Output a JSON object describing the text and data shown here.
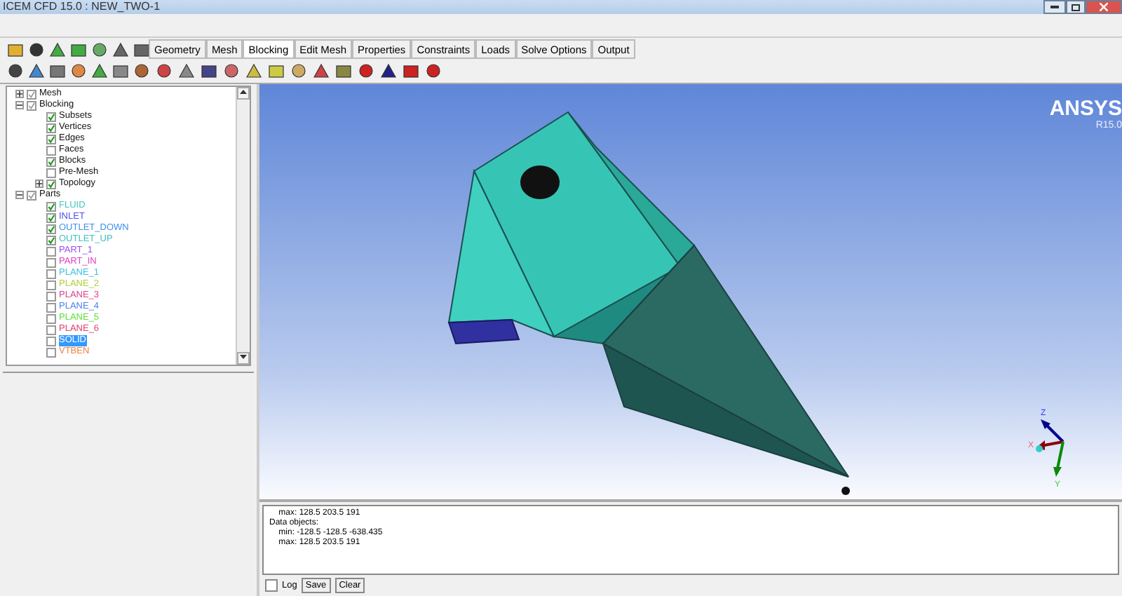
{
  "window": {
    "title": "ICEM CFD 15.0 : NEW_TWO-1"
  },
  "tabs": [
    {
      "label": "Geometry",
      "selected": false
    },
    {
      "label": "Mesh",
      "selected": false
    },
    {
      "label": "Blocking",
      "selected": true
    },
    {
      "label": "Edit Mesh",
      "selected": false
    },
    {
      "label": "Properties",
      "selected": false
    },
    {
      "label": "Constraints",
      "selected": false
    },
    {
      "label": "Loads",
      "selected": false
    },
    {
      "label": "Solve Options",
      "selected": false
    },
    {
      "label": "Output",
      "selected": false
    }
  ],
  "tree": [
    {
      "label": "Mesh",
      "checked": true,
      "expanded": false,
      "selected": false
    },
    {
      "label": "Blocking",
      "checked": true,
      "expanded": true,
      "selected": false,
      "children": [
        {
          "label": "Subsets",
          "checked": true,
          "selected": false
        },
        {
          "label": "Vertices",
          "checked": true,
          "selected": false
        },
        {
          "label": "Edges",
          "checked": true,
          "selected": false
        },
        {
          "label": "Faces",
          "checked": false,
          "selected": false
        },
        {
          "label": "Blocks",
          "checked": true,
          "selected": false
        },
        {
          "label": "Pre-Mesh",
          "checked": false,
          "selected": false
        },
        {
          "label": "Topology",
          "checked": true,
          "selected": false,
          "expanded": false
        }
      ]
    },
    {
      "label": "Parts",
      "checked": true,
      "expanded": true,
      "selected": false,
      "children": [
        {
          "label": "FLUID",
          "checked": true,
          "selected": false,
          "color": "#40c8c0"
        },
        {
          "label": "INLET",
          "checked": true,
          "selected": false,
          "color": "#5050f0"
        },
        {
          "label": "OUTLET_DOWN",
          "checked": true,
          "selected": false,
          "color": "#4090f0"
        },
        {
          "label": "OUTLET_UP",
          "checked": true,
          "selected": false,
          "color": "#40c0c0"
        },
        {
          "label": "PART_1",
          "checked": false,
          "selected": false,
          "color": "#a050f0"
        },
        {
          "label": "PART_IN",
          "checked": false,
          "selected": false,
          "color": "#e040c0"
        },
        {
          "label": "PLANE_1",
          "checked": false,
          "selected": false,
          "color": "#40c0e0"
        },
        {
          "label": "PLANE_2",
          "checked": false,
          "selected": false,
          "color": "#b0d040"
        },
        {
          "label": "PLANE_3",
          "checked": false,
          "selected": false,
          "color": "#e04090"
        },
        {
          "label": "PLANE_4",
          "checked": false,
          "selected": false,
          "color": "#5080f0"
        },
        {
          "label": "PLANE_5",
          "checked": false,
          "selected": false,
          "color": "#60e040"
        },
        {
          "label": "PLANE_6",
          "checked": false,
          "selected": false,
          "color": "#e04070"
        },
        {
          "label": "SOLID",
          "checked": false,
          "selected": true
        },
        {
          "label": "VTBEN",
          "checked": false,
          "selected": false,
          "color": "#f08040"
        }
      ]
    }
  ],
  "viewport": {
    "brand": "ANSYS",
    "version": "R15.0",
    "axes": {
      "x": "X",
      "y": "Y",
      "z": "Z"
    }
  },
  "messages": [
    "    max: 128.5 203.5 191",
    "Data objects:",
    "    min: -128.5 -128.5 -638.435",
    "    max: 128.5 203.5 191"
  ],
  "message_controls": {
    "log": {
      "label": "Log",
      "checked": false
    },
    "buttons": [
      "Save",
      "Clear"
    ]
  }
}
